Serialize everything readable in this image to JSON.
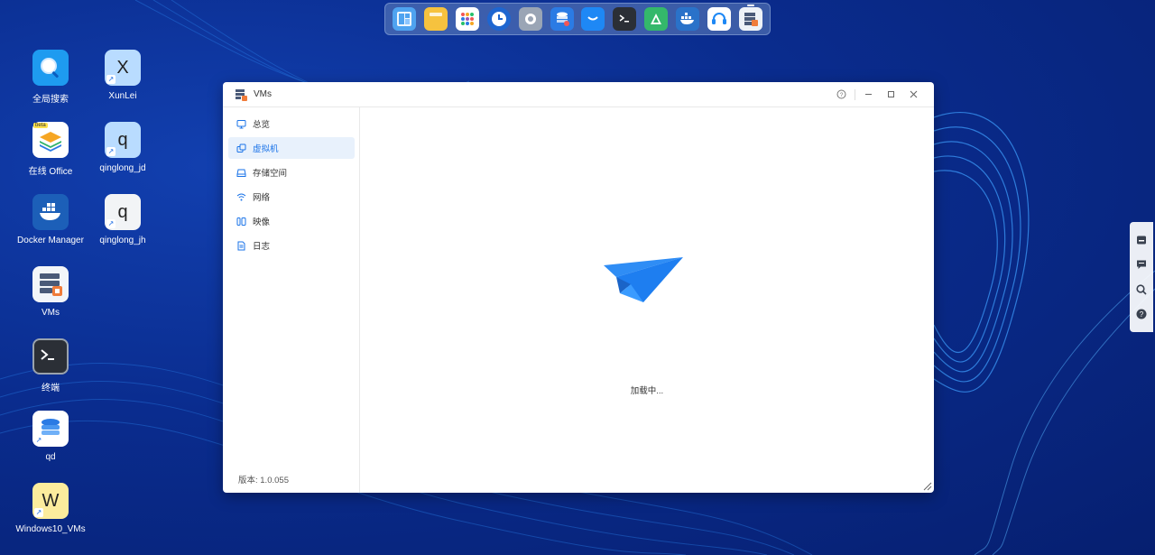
{
  "dock": {
    "items": [
      {
        "name": "dashboard-app-icon",
        "color": "#4fa3f0"
      },
      {
        "name": "notes-app-icon",
        "color": "#f6c23e"
      },
      {
        "name": "app-center-icon",
        "color": "#ffffff"
      },
      {
        "name": "clock-app-icon",
        "color": "#1e66d0"
      },
      {
        "name": "settings-app-icon",
        "color": "#9aa5b5"
      },
      {
        "name": "database-app-icon",
        "color": "#2b7be4"
      },
      {
        "name": "store-app-icon",
        "color": "#1e88f5"
      },
      {
        "name": "terminal-app-icon",
        "color": "#2b2f36"
      },
      {
        "name": "upload-app-icon",
        "color": "#34b86b"
      },
      {
        "name": "docker-app-icon",
        "color": "#2a72c9"
      },
      {
        "name": "support-app-icon",
        "color": "#ffffff"
      },
      {
        "name": "vms-app-icon",
        "color": "#eef2f7"
      }
    ]
  },
  "desktop": {
    "icons": [
      {
        "label": "全局搜索"
      },
      {
        "label": "XunLei",
        "letter": "X"
      },
      {
        "label": "在线 Office",
        "badge": "beta"
      },
      {
        "label": "qinglong_jd",
        "letter": "q"
      },
      {
        "label": "Docker Manager"
      },
      {
        "label": "qinglong_jh",
        "letter": "q"
      },
      {
        "label": "VMs"
      },
      {
        "label": "终端"
      },
      {
        "label": "qd"
      },
      {
        "label": "Windows10_VMs",
        "letter": "W"
      }
    ]
  },
  "window": {
    "title": "VMs",
    "sidebar": {
      "items": [
        {
          "label": "总览"
        },
        {
          "label": "虚拟机"
        },
        {
          "label": "存储空间"
        },
        {
          "label": "网络"
        },
        {
          "label": "映像"
        },
        {
          "label": "日志"
        }
      ],
      "active_index": 1,
      "version": "版本: 1.0.055"
    },
    "content": {
      "loading_text": "加载中..."
    }
  },
  "colors": {
    "accent": "#1a73e8",
    "desktop_bg": "#0a2a8c",
    "active_nav_bg": "#e8f1fc"
  }
}
